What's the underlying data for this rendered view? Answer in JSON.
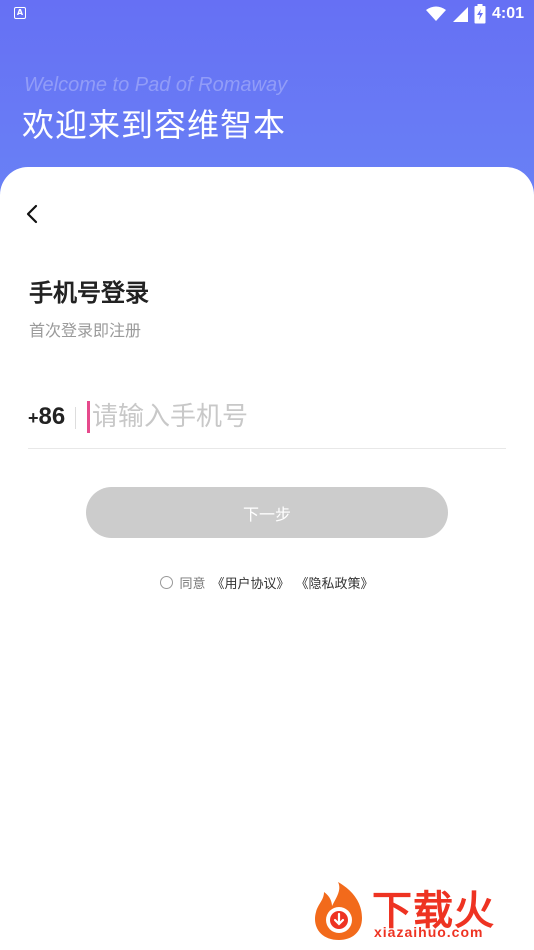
{
  "status_bar": {
    "time": "4:01",
    "left_icon_letter": "A",
    "icons": [
      "notification-a-icon",
      "wifi-icon",
      "signal-icon",
      "battery-icon"
    ]
  },
  "header": {
    "welcome_en": "Welcome to Pad of Romaway",
    "welcome_cn": "欢迎来到容维智本"
  },
  "login": {
    "title": "手机号登录",
    "subtitle": "首次登录即注册",
    "country_code_plus": "+",
    "country_code_num": "86",
    "phone_placeholder": "请输入手机号",
    "phone_value": "",
    "next_label": "下一步",
    "agree_prefix": "同意",
    "user_agreement": "《用户协议》",
    "privacy_policy": "《隐私政策》"
  },
  "watermark": {
    "name": "下载火",
    "url": "xiazaihuo.com"
  },
  "colors": {
    "header_gradient_top": "#6670f4",
    "header_gradient_bottom": "#6a86f6",
    "button_disabled": "#cccccc",
    "caret": "#e64a8c",
    "watermark": "#ee3322"
  }
}
